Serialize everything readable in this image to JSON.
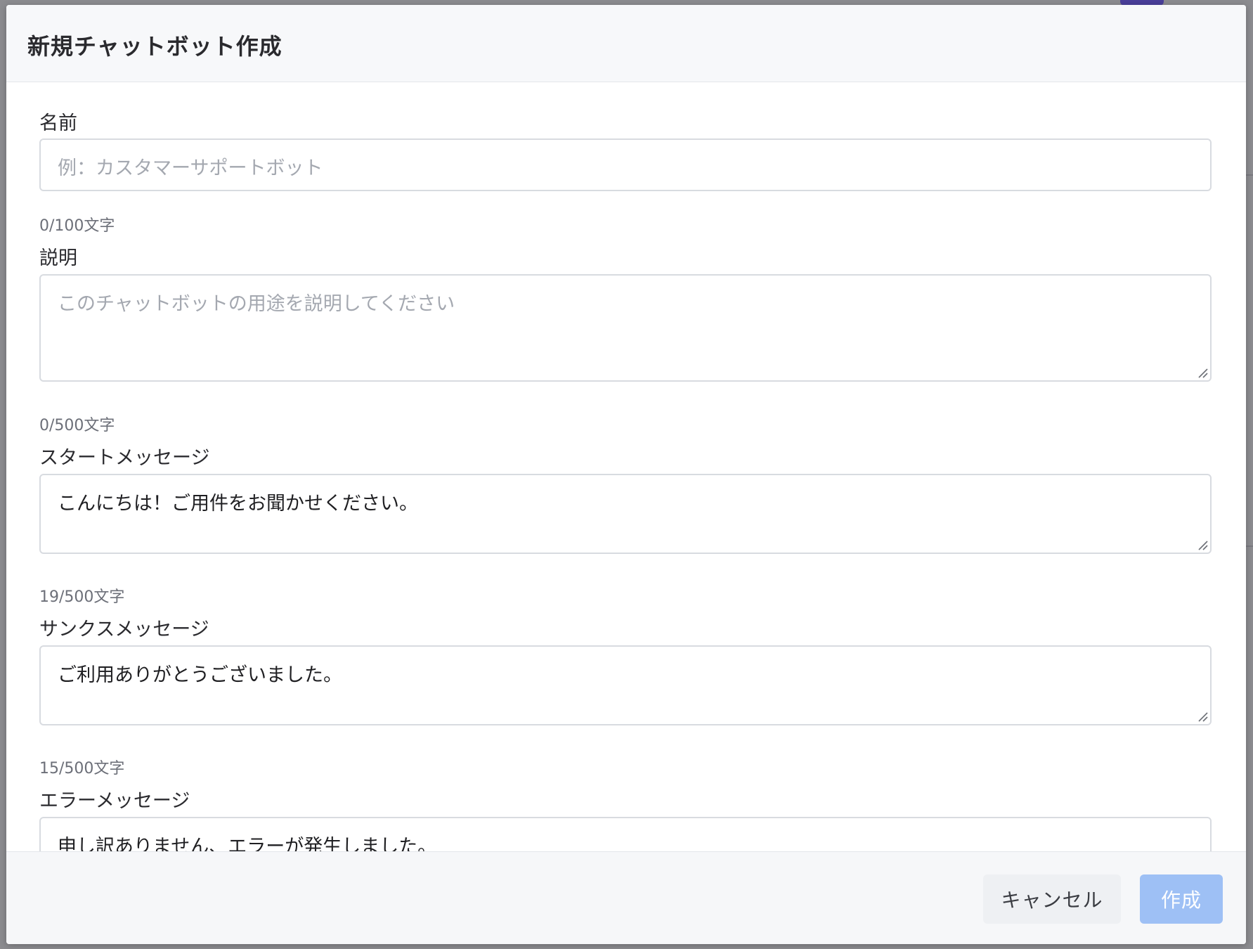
{
  "dialog": {
    "title": "新規チャットボット作成"
  },
  "fields": {
    "name": {
      "label": "名前",
      "value": "",
      "placeholder": "例：カスタマーサポートボット",
      "counter": "0/100文字"
    },
    "description": {
      "label": "説明",
      "value": "",
      "placeholder": "このチャットボットの用途を説明してください",
      "counter": "0/500文字"
    },
    "start_message": {
      "label": "スタートメッセージ",
      "value": "こんにちは！ご用件をお聞かせください。",
      "counter": "19/500文字"
    },
    "thanks_message": {
      "label": "サンクスメッセージ",
      "value": "ご利用ありがとうございました。",
      "counter": "15/500文字"
    },
    "error_message": {
      "label": "エラーメッセージ",
      "value": "申し訳ありません、エラーが発生しました。"
    }
  },
  "footer": {
    "cancel_label": "キャンセル",
    "create_label": "作成"
  },
  "colors": {
    "primary_disabled": "#9ec0f5",
    "header_bg": "#f7f8fa",
    "border": "#d8dbe0"
  }
}
